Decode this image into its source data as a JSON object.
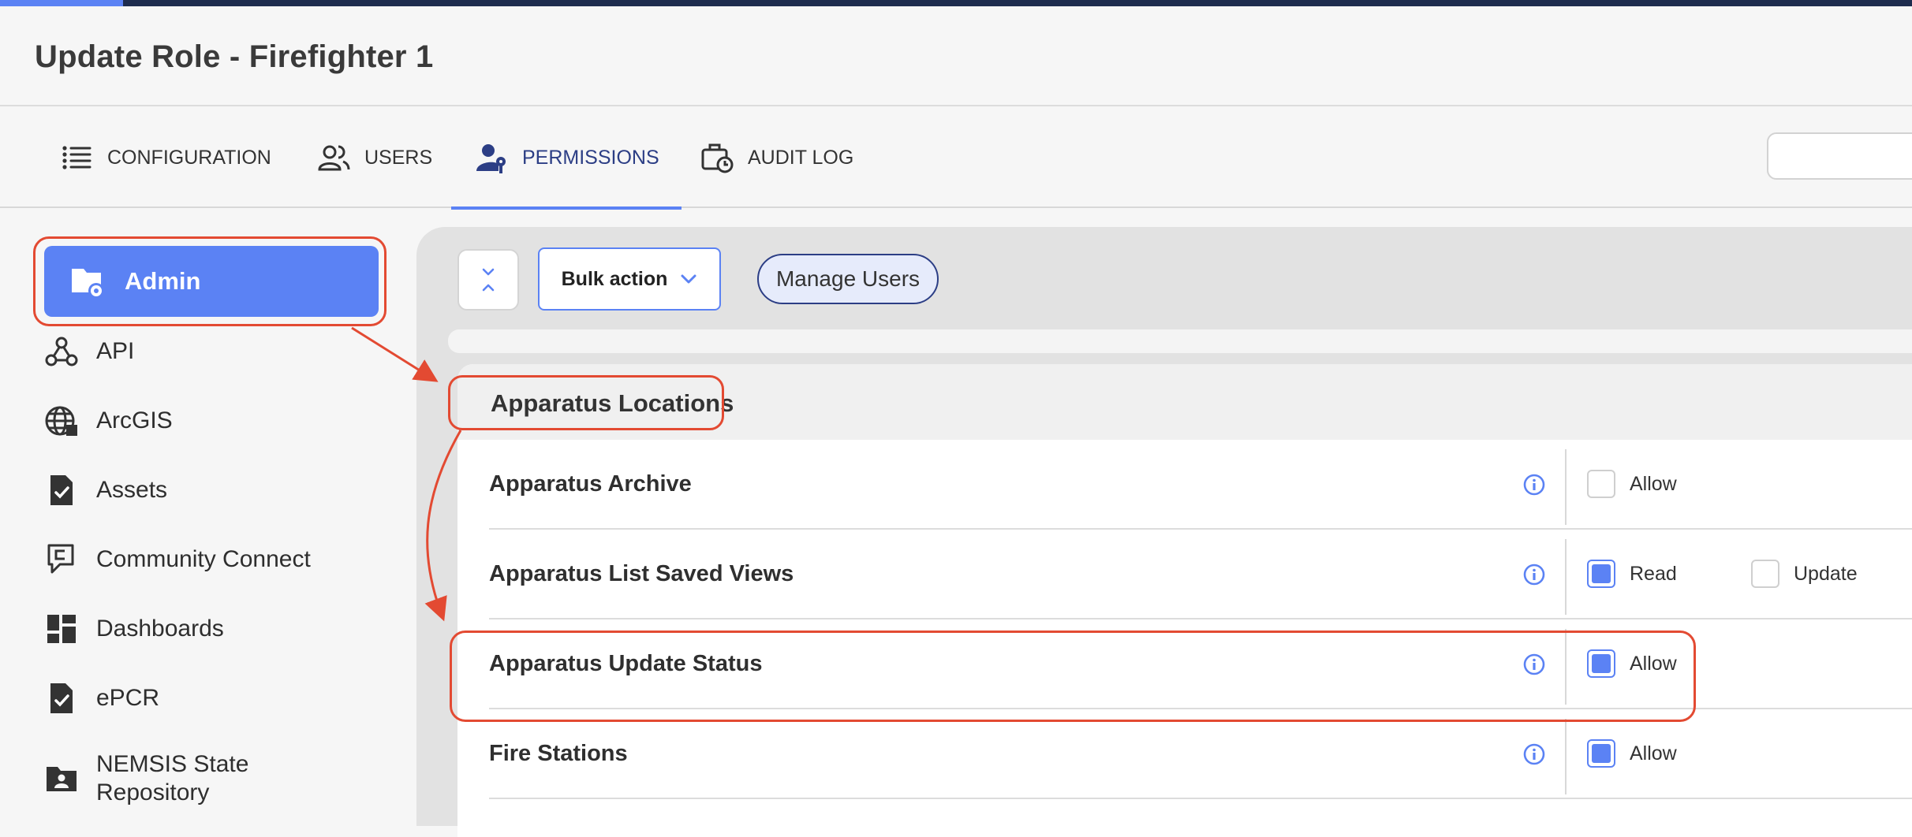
{
  "header": {
    "title": "Update Role - Firefighter 1"
  },
  "tabs": [
    {
      "label": "CONFIGURATION",
      "icon": "list-icon"
    },
    {
      "label": "USERS",
      "icon": "users-icon"
    },
    {
      "label": "PERMISSIONS",
      "icon": "user-key-icon",
      "active": true
    },
    {
      "label": "AUDIT LOG",
      "icon": "briefcase-clock-icon"
    }
  ],
  "sidebar": {
    "items": [
      {
        "label": "Admin",
        "icon": "folder-gear-icon",
        "active": true
      },
      {
        "label": "API",
        "icon": "webhook-icon"
      },
      {
        "label": "ArcGIS",
        "icon": "globe-grid-icon"
      },
      {
        "label": "Assets",
        "icon": "file-check-icon"
      },
      {
        "label": "Community Connect",
        "icon": "community-connect-icon"
      },
      {
        "label": "Dashboards",
        "icon": "dashboard-grid-icon"
      },
      {
        "label": "ePCR",
        "icon": "file-check-icon"
      },
      {
        "label": "NEMSIS State",
        "label2": "Repository",
        "icon": "folder-person-icon"
      }
    ]
  },
  "toolbar": {
    "bulk_action": "Bulk action",
    "manage_users": "Manage Users"
  },
  "section": {
    "title": "Apparatus Locations",
    "rows": [
      {
        "label": "Apparatus Archive",
        "options": [
          {
            "label": "Allow",
            "checked": false
          }
        ]
      },
      {
        "label": "Apparatus List Saved Views",
        "options": [
          {
            "label": "Read",
            "checked": true
          },
          {
            "label": "Update",
            "checked": false
          }
        ]
      },
      {
        "label": "Apparatus Update Status",
        "options": [
          {
            "label": "Allow",
            "checked": true
          }
        ]
      },
      {
        "label": "Fire Stations",
        "options": [
          {
            "label": "Allow",
            "checked": true
          }
        ]
      }
    ]
  },
  "colors": {
    "accent": "#5b82f4",
    "nav_dark": "#1e2c4e",
    "annotation": "#e34a32"
  }
}
